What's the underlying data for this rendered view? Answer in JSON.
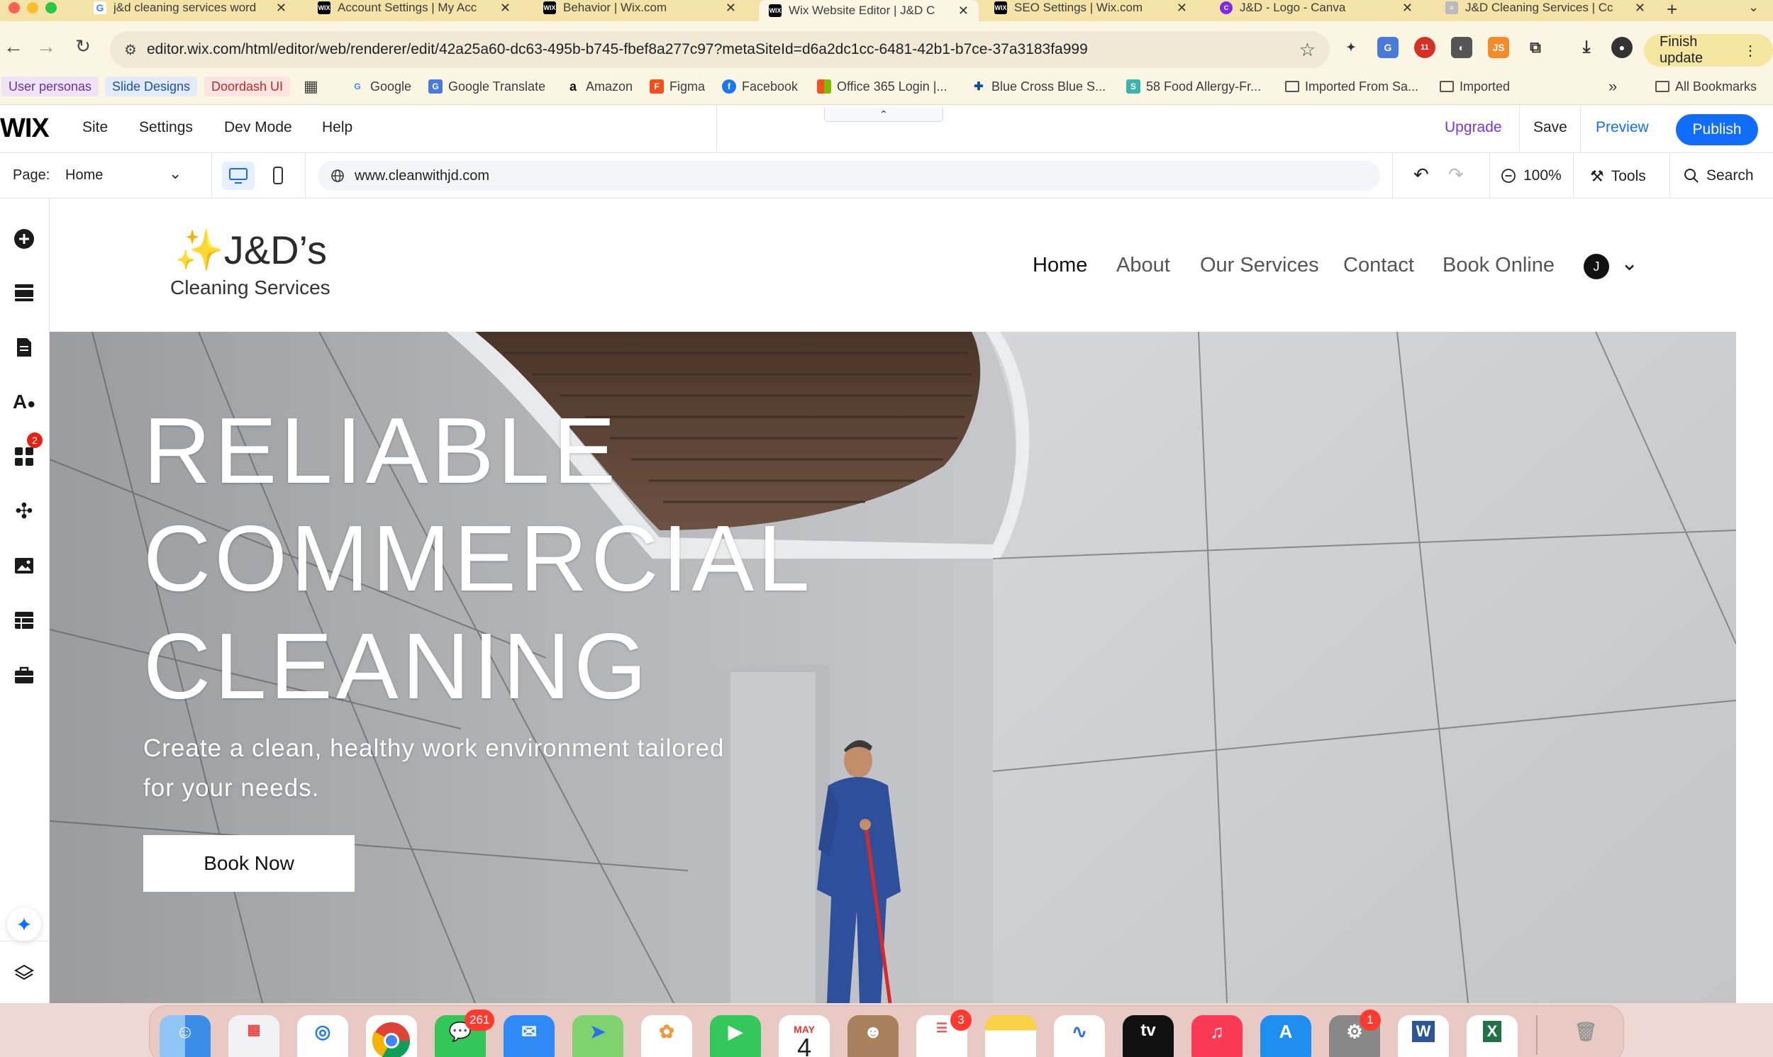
{
  "browser": {
    "tabs": [
      {
        "title": "j&d cleaning services word",
        "favicon": "google-icon",
        "active": false
      },
      {
        "title": "Account Settings | My Acc",
        "favicon": "wix-icon",
        "active": false
      },
      {
        "title": "Behavior | Wix.com",
        "favicon": "wix-icon",
        "active": false
      },
      {
        "title": "Wix Website Editor | J&D C",
        "favicon": "wix-icon",
        "active": true
      },
      {
        "title": "SEO Settings | Wix.com",
        "favicon": "wix-icon",
        "active": false
      },
      {
        "title": "J&D - Logo - Canva",
        "favicon": "canva-icon",
        "active": false
      },
      {
        "title": "J&D Cleaning Services | Cc",
        "favicon": "site-icon",
        "active": false
      }
    ],
    "url": "editor.wix.com/html/editor/web/renderer/edit/42a25a60-dc63-495b-b745-fbef8a277c97?metaSiteId=d6a2dc1cc-6481-42b1-b7ce-37a3183fa999",
    "finish_update": "Finish update",
    "extension_badge": "11",
    "bookmarks": [
      "User personas",
      "Slide Designs",
      "Doordash UI",
      "Google",
      "Google Translate",
      "Amazon",
      "Figma",
      "Facebook",
      "Office 365 Login |...",
      "Blue Cross Blue S...",
      "58 Food Allergy-Fr...",
      "Imported From Sa...",
      "Imported"
    ],
    "more_bookmarks": "»",
    "all_bookmarks": "All Bookmarks"
  },
  "wix": {
    "logo": "WIX",
    "menu": [
      "Site",
      "Settings",
      "Dev Mode",
      "Help"
    ],
    "upgrade": "Upgrade",
    "save": "Save",
    "preview": "Preview",
    "publish": "Publish",
    "page_label": "Page:",
    "page_value": "Home",
    "site_url": "www.cleanwithjd.com",
    "zoom": "100%",
    "tools": "Tools",
    "search": "Search",
    "apps_badge": "2",
    "colors": {
      "accent": "#116dff",
      "upgrade": "#7a33e6",
      "badge": "#e62214"
    }
  },
  "site": {
    "logo_sparkle": "✨",
    "logo_main": "J&D’s",
    "logo_sub": "Cleaning Services",
    "nav": [
      "Home",
      "About",
      "Our Services",
      "Contact",
      "Book Online"
    ],
    "avatar_initial": "J",
    "hero": {
      "title_lines": [
        "RELIABLE",
        "COMMERCIAL",
        "CLEANING"
      ],
      "subtitle": "Create a clean, healthy work environment tailored for your needs.",
      "cta": "Book Now"
    }
  },
  "dock": {
    "messages_badge": "261",
    "calendar_month": "MAY",
    "calendar_day": "4",
    "reminders_badge": "3",
    "settings_badge": "1",
    "tv_label": "tv"
  }
}
